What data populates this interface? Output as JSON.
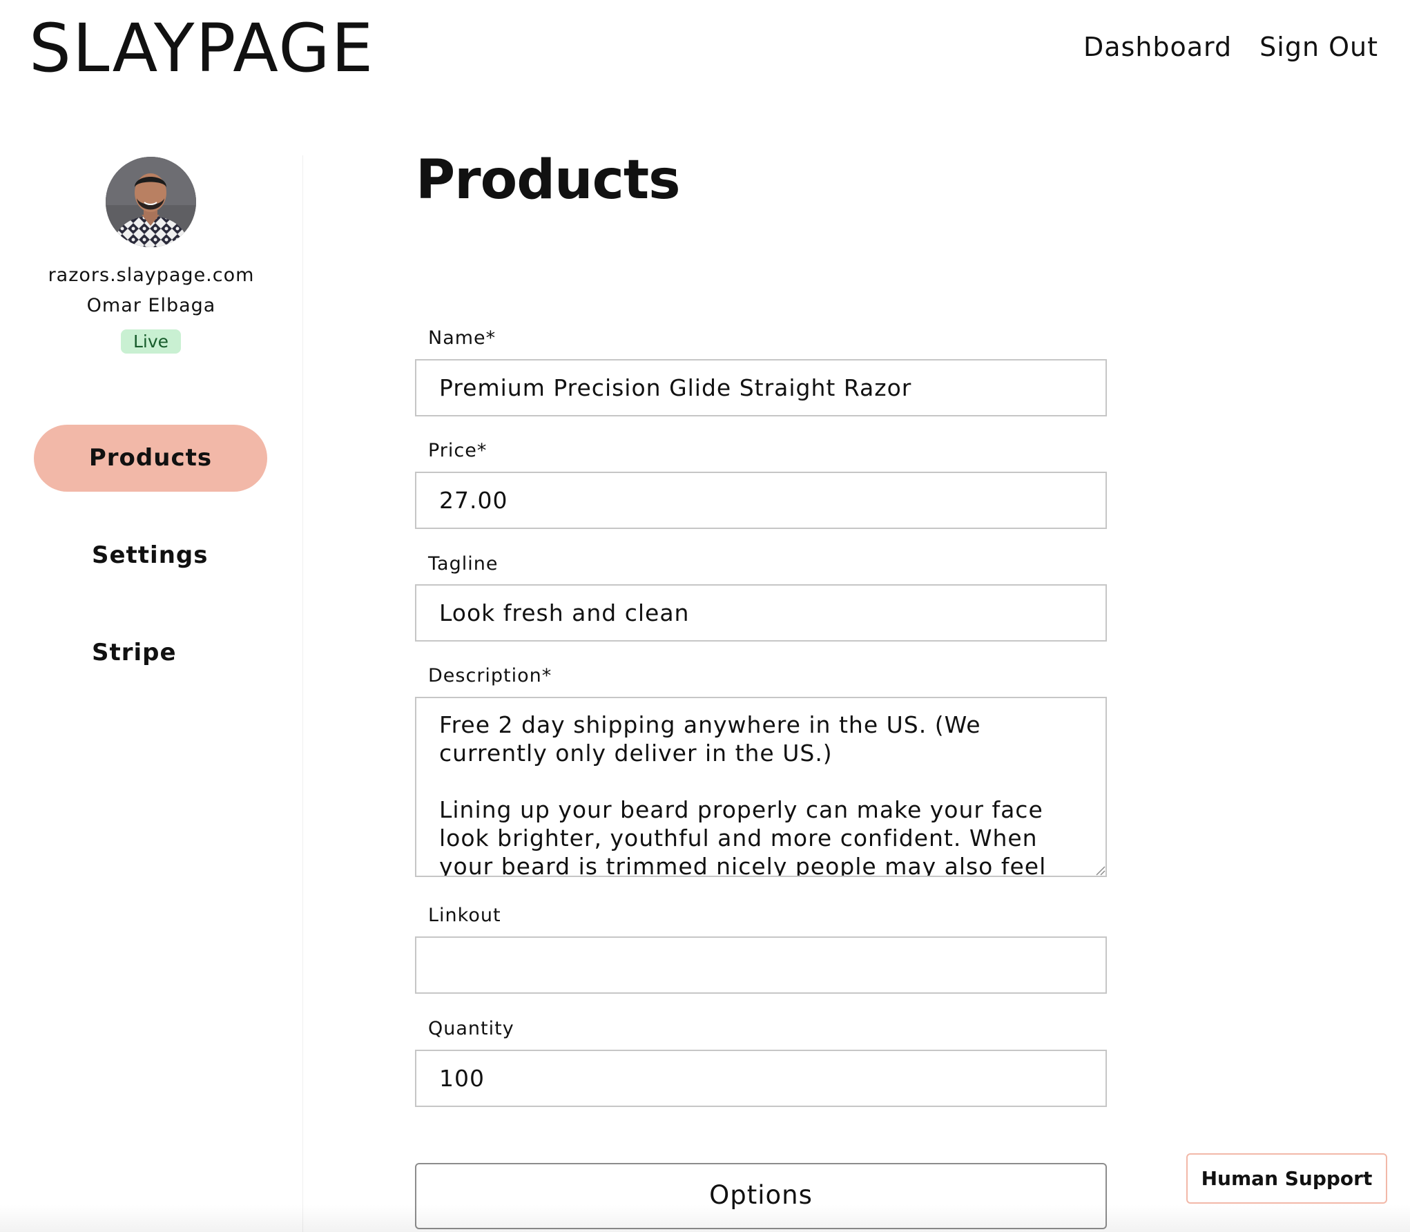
{
  "header": {
    "logo": "SLAYPAGE",
    "nav": {
      "dashboard": "Dashboard",
      "sign_out": "Sign Out"
    }
  },
  "sidebar": {
    "profile": {
      "domain": "razors.slaypage.com",
      "name": "Omar Elbaga",
      "status": "Live"
    },
    "items": [
      {
        "label": "Products",
        "active": true
      },
      {
        "label": "Settings",
        "active": false
      },
      {
        "label": "Stripe",
        "active": false
      }
    ]
  },
  "main": {
    "title": "Products",
    "form": {
      "name": {
        "label": "Name*",
        "value": "Premium Precision Glide Straight Razor"
      },
      "price": {
        "label": "Price*",
        "value": "27.00"
      },
      "tagline": {
        "label": "Tagline",
        "value": "Look fresh and clean"
      },
      "description": {
        "label": "Description*",
        "value": "Free 2 day shipping anywhere in the US. (We currently only deliver in the US.)\n\nLining up your beard properly can make your face look brighter, youthful and more confident. When your beard is trimmed nicely people may also feel"
      },
      "linkout": {
        "label": "Linkout",
        "value": ""
      },
      "quantity": {
        "label": "Quantity",
        "value": "100"
      }
    },
    "options_button": "Options"
  },
  "support": {
    "label": "Human Support"
  },
  "colors": {
    "accent": "#f2b8a8",
    "live_badge": "#c9f0d2",
    "border": "#c6c6c6"
  }
}
